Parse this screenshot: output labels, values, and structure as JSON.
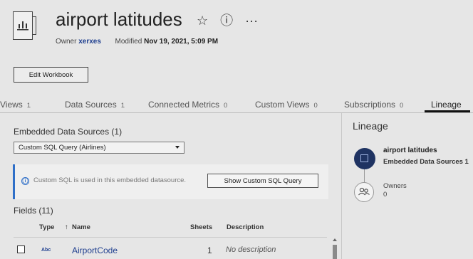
{
  "workbook": {
    "title": "airport latitudes",
    "owner_label": "Owner",
    "owner": "xerxes",
    "modified_label": "Modified",
    "modified": "Nov 19, 2021, 5:09 PM",
    "edit_button": "Edit Workbook",
    "actions": {
      "favorite": "☆",
      "info": "ⓘ",
      "more": "···"
    }
  },
  "tabs": [
    {
      "label": "Views",
      "count": "1"
    },
    {
      "label": "Data Sources",
      "count": "1"
    },
    {
      "label": "Connected Metrics",
      "count": "0"
    },
    {
      "label": "Custom Views",
      "count": "0"
    },
    {
      "label": "Subscriptions",
      "count": "0"
    },
    {
      "label": "Lineage",
      "count": ""
    }
  ],
  "left": {
    "embedded_title": "Embedded Data Sources (1)",
    "selected_source": "Custom SQL Query (Airlines)",
    "banner_icon": "ⓘ",
    "banner_text": "Custom SQL is used in this embedded datasource.",
    "banner_button": "Show Custom SQL Query",
    "fields_title": "Fields (11)",
    "columns": {
      "type": "Type",
      "sort_arrow": "↑",
      "name": "Name",
      "sheets": "Sheets",
      "description": "Description"
    },
    "rows": [
      {
        "type": "Abc",
        "name": "AirportCode",
        "sheets": "1",
        "description": "No description"
      }
    ]
  },
  "lineage": {
    "title": "Lineage",
    "node_name": "airport latitudes",
    "node_sub": "Embedded Data Sources 1",
    "owners_label": "Owners",
    "owners_count": "0"
  },
  "icons": {
    "workbook": "bar-chart-workbook-icon",
    "owners": "people-icon"
  },
  "colors": {
    "accent": "#2f6fc8",
    "link": "#1f3f8f",
    "lineage_node": "#1f3362",
    "background": "#e6e6e6"
  }
}
